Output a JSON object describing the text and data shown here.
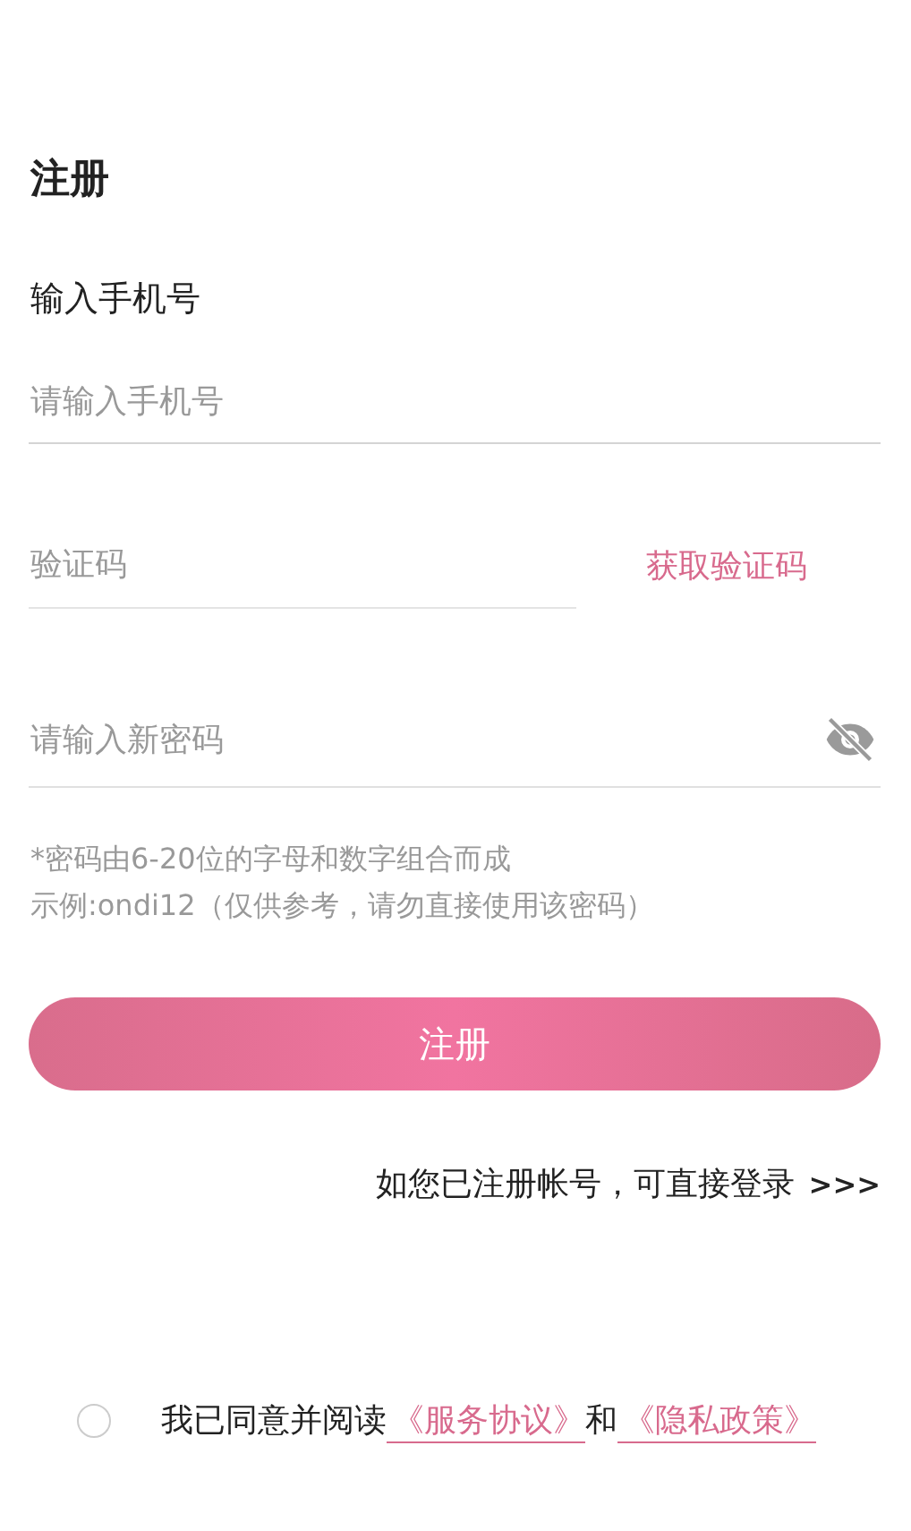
{
  "title": "注册",
  "phone": {
    "label": "输入手机号",
    "placeholder": "请输入手机号"
  },
  "code": {
    "placeholder": "验证码",
    "action": "获取验证码"
  },
  "password": {
    "placeholder": "请输入新密码",
    "visible": false
  },
  "hints": [
    "*密码由6-20位的字母和数字组合而成",
    "示例:ondi12（仅供参考，请勿直接使用该密码）"
  ],
  "submit": "注册",
  "login": {
    "text": "如您已注册帐号，可直接登录",
    "arrow": ">>>"
  },
  "agreement": {
    "checked": false,
    "parts": [
      {
        "kind": "text",
        "text": "我已同意并阅读"
      },
      {
        "kind": "link",
        "text": "《服务协议》"
      },
      {
        "kind": "text",
        "text": "和"
      },
      {
        "kind": "link",
        "text": "《隐私政策》"
      }
    ]
  }
}
